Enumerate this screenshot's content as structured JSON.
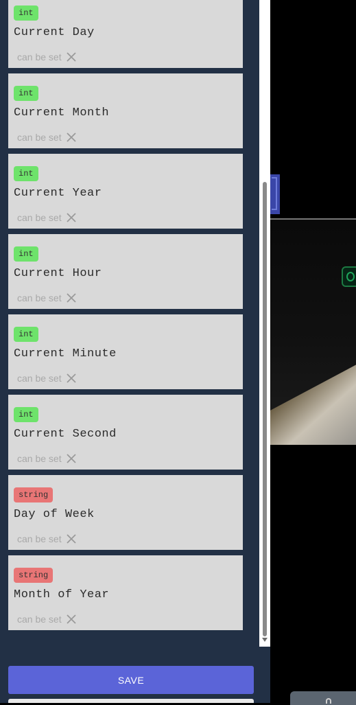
{
  "variables": [
    {
      "type": "int",
      "name": "Current Day",
      "status": "can be set"
    },
    {
      "type": "int",
      "name": "Current Month",
      "status": "can be set"
    },
    {
      "type": "int",
      "name": "Current Year",
      "status": "can be set"
    },
    {
      "type": "int",
      "name": "Current Hour",
      "status": "can be set"
    },
    {
      "type": "int",
      "name": "Current Minute",
      "status": "can be set"
    },
    {
      "type": "int",
      "name": "Current Second",
      "status": "can be set"
    },
    {
      "type": "string",
      "name": "Day of Week",
      "status": "can be set"
    },
    {
      "type": "string",
      "name": "Month of Year",
      "status": "can be set"
    }
  ],
  "footer": {
    "save_label": "SAVE"
  },
  "colors": {
    "int_badge": "#6ee36b",
    "string_badge": "#e87575",
    "panel_bg": "#223045",
    "card_bg": "#d9d9d9",
    "save_button": "#5b64d8"
  },
  "icons": {
    "status_icon": "close-icon"
  }
}
